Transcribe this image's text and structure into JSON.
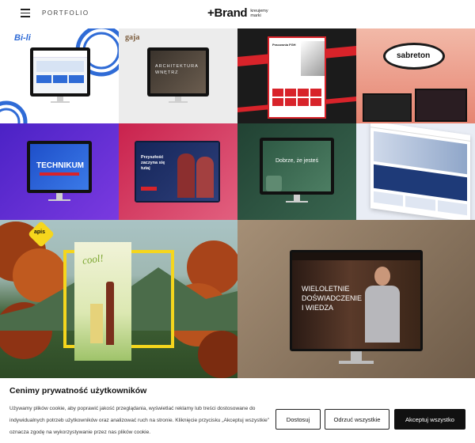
{
  "header": {
    "nav_label": "PORTFOLIO",
    "logo_main": "+Brand",
    "logo_tag": "kreujemy marki"
  },
  "portfolio": {
    "tiles": [
      {
        "name": "Bisli",
        "logo_text": "Bi-li"
      },
      {
        "name": "gaja",
        "logo_text": "gaja",
        "screen_text": "ARCHITEKTURA WNĘTRZ"
      },
      {
        "name": "red-website",
        "screen_text": "Pracownia FGH"
      },
      {
        "name": "sabre-ton",
        "logo_text": "sabreton"
      },
      {
        "name": "technikum",
        "screen_text": "TECHNIKUM"
      },
      {
        "name": "graduates",
        "screen_text": "Przyszłość zaczyna się tutaj"
      },
      {
        "name": "dobrze-ze-jestes",
        "screen_text": "Dobrze, że jesteś"
      },
      {
        "name": "blue-site",
        "screen_text": ""
      },
      {
        "name": "apis",
        "logo_text": "apis",
        "label_text": "cool!"
      },
      {
        "name": "experience",
        "screen_text": "WIELOLETNIE DOŚWIADCZENIE I WIEDZA"
      }
    ]
  },
  "cookie": {
    "title": "Cenimy prywatność użytkowników",
    "text": "Używamy plików cookie, aby poprawić jakość przeglądania, wyświetlać reklamy lub treści dostosowane do indywidualnych potrzeb użytkowników oraz analizować ruch na stronie. Kliknięcie przycisku „Akceptuj wszystkie” oznacza zgodę na wykorzystywanie przez nas plików cookie.",
    "customize_label": "Dostosuj",
    "reject_label": "Odrzuć wszystkie",
    "accept_label": "Akceptuj wszystko"
  },
  "colors": {
    "accent_dark": "#111111",
    "red": "#d8232a",
    "yellow": "#f5d61d",
    "purple": "#5a2fd6",
    "green": "#2f5a45"
  }
}
